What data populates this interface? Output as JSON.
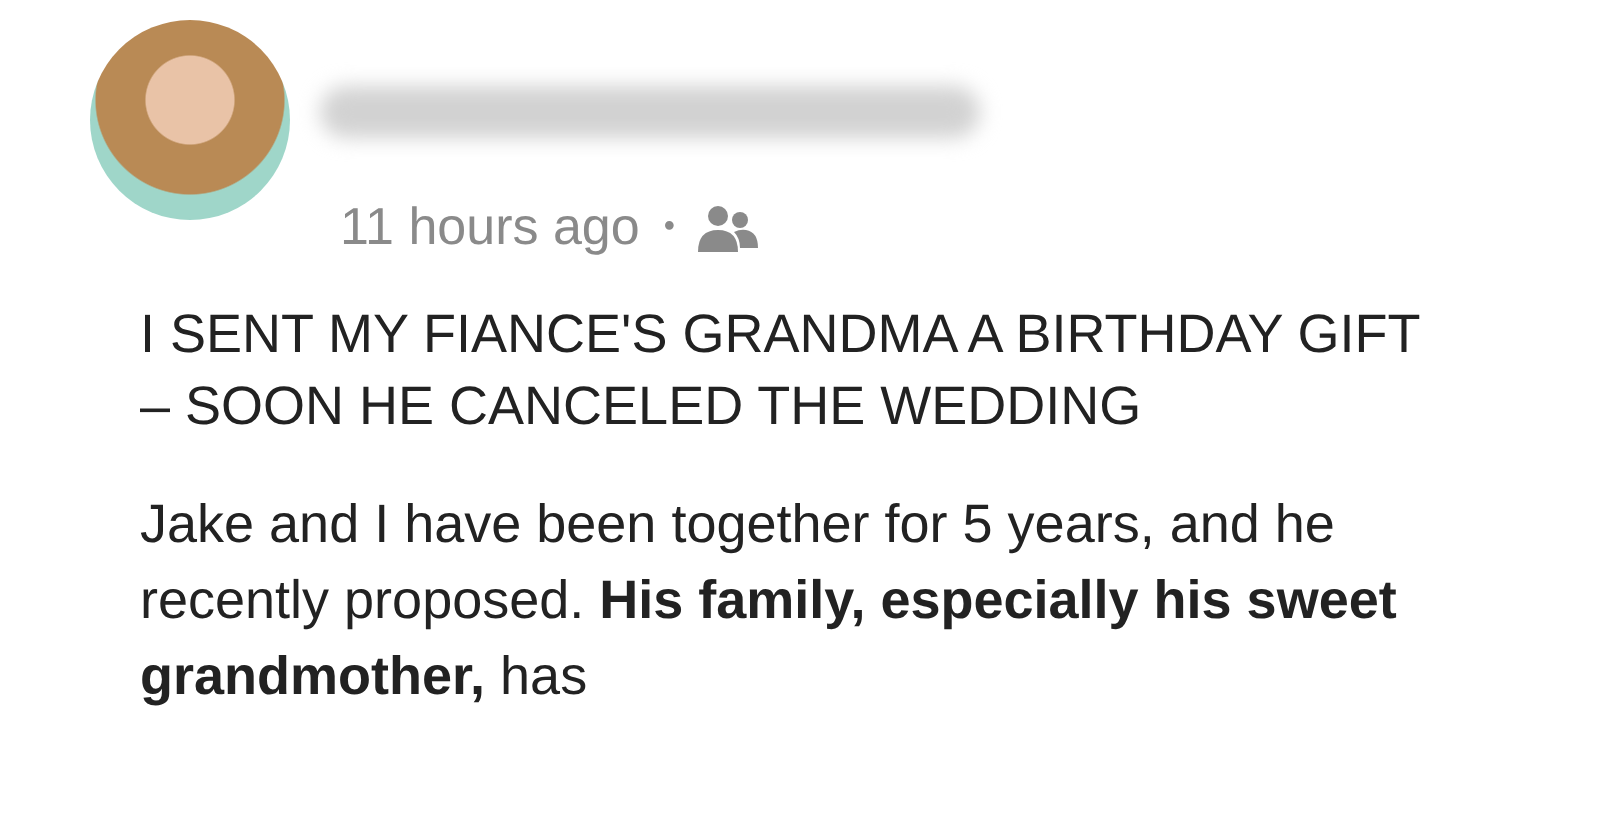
{
  "post": {
    "time": "11 hours ago",
    "separator": "•",
    "title": "I SENT MY FIANCE'S GRANDMA A BIRTHDAY GIFT – SOON HE CANCELED THE WEDDING",
    "body": "Jake and I have been together for 5 years, and he recently proposed. **His family, especially his sweet grandmother,** has"
  }
}
